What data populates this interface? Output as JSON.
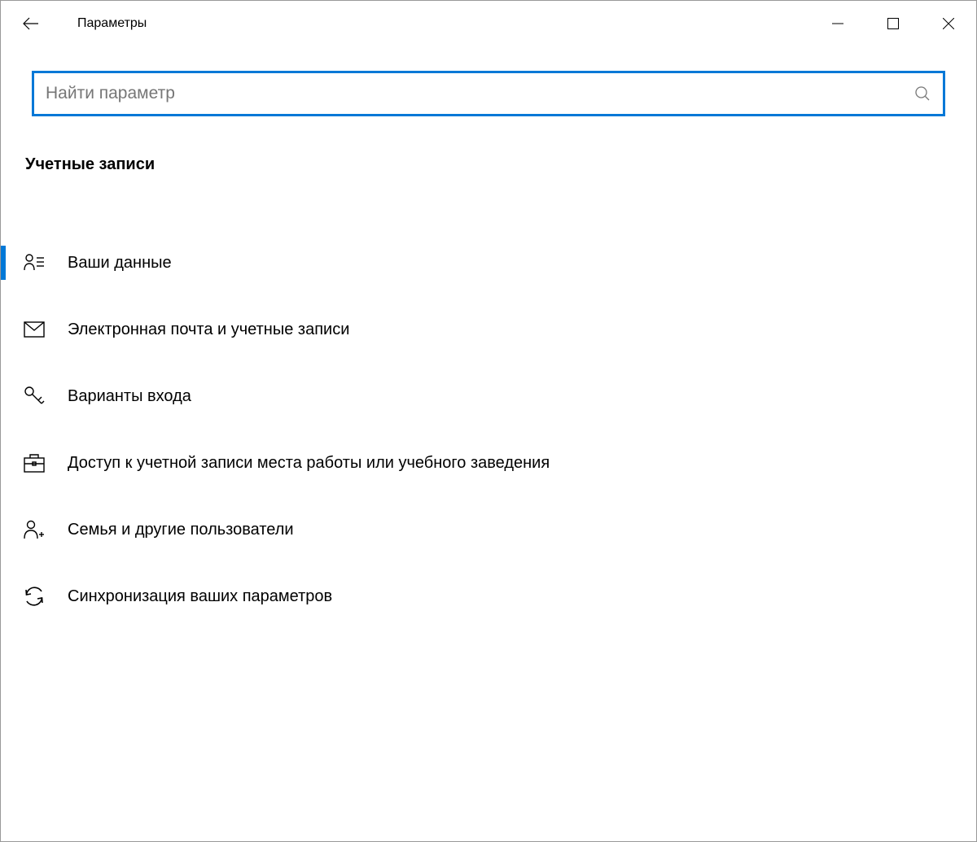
{
  "header": {
    "title": "Параметры"
  },
  "search": {
    "placeholder": "Найти параметр",
    "value": ""
  },
  "section": {
    "heading": "Учетные записи"
  },
  "menu": {
    "items": [
      {
        "label": "Ваши данные",
        "icon": "person-list-icon",
        "active": true
      },
      {
        "label": "Электронная почта и учетные записи",
        "icon": "mail-icon",
        "active": false
      },
      {
        "label": "Варианты входа",
        "icon": "key-icon",
        "active": false
      },
      {
        "label": "Доступ к учетной записи места работы или учебного заведения",
        "icon": "briefcase-icon",
        "active": false
      },
      {
        "label": "Семья и другие пользователи",
        "icon": "person-add-icon",
        "active": false
      },
      {
        "label": "Синхронизация ваших параметров",
        "icon": "sync-icon",
        "active": false
      }
    ]
  },
  "colors": {
    "accent": "#0078d7"
  }
}
